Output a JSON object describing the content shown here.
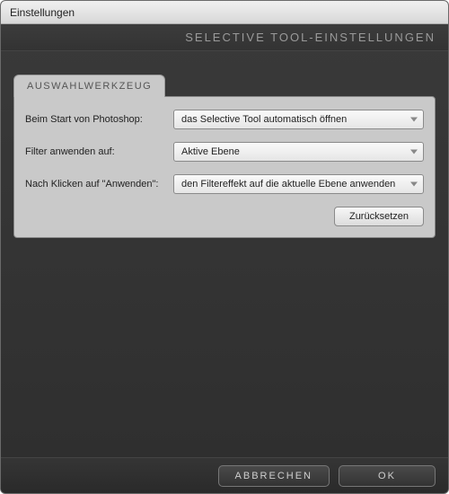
{
  "window": {
    "title": "Einstellungen"
  },
  "subheader": {
    "text": "SELECTIVE TOOL-EINSTELLUNGEN"
  },
  "tab": {
    "label": "AUSWAHLWERKZEUG"
  },
  "settings": {
    "startup": {
      "label": "Beim Start von Photoshop:",
      "value": "das Selective Tool automatisch öffnen"
    },
    "filter_target": {
      "label": "Filter anwenden auf:",
      "value": "Aktive Ebene"
    },
    "on_apply": {
      "label": "Nach Klicken auf \"Anwenden\":",
      "value": "den Filtereffekt auf die aktuelle Ebene anwenden"
    }
  },
  "buttons": {
    "reset": "Zurücksetzen",
    "cancel": "ABBRECHEN",
    "ok": "OK"
  }
}
